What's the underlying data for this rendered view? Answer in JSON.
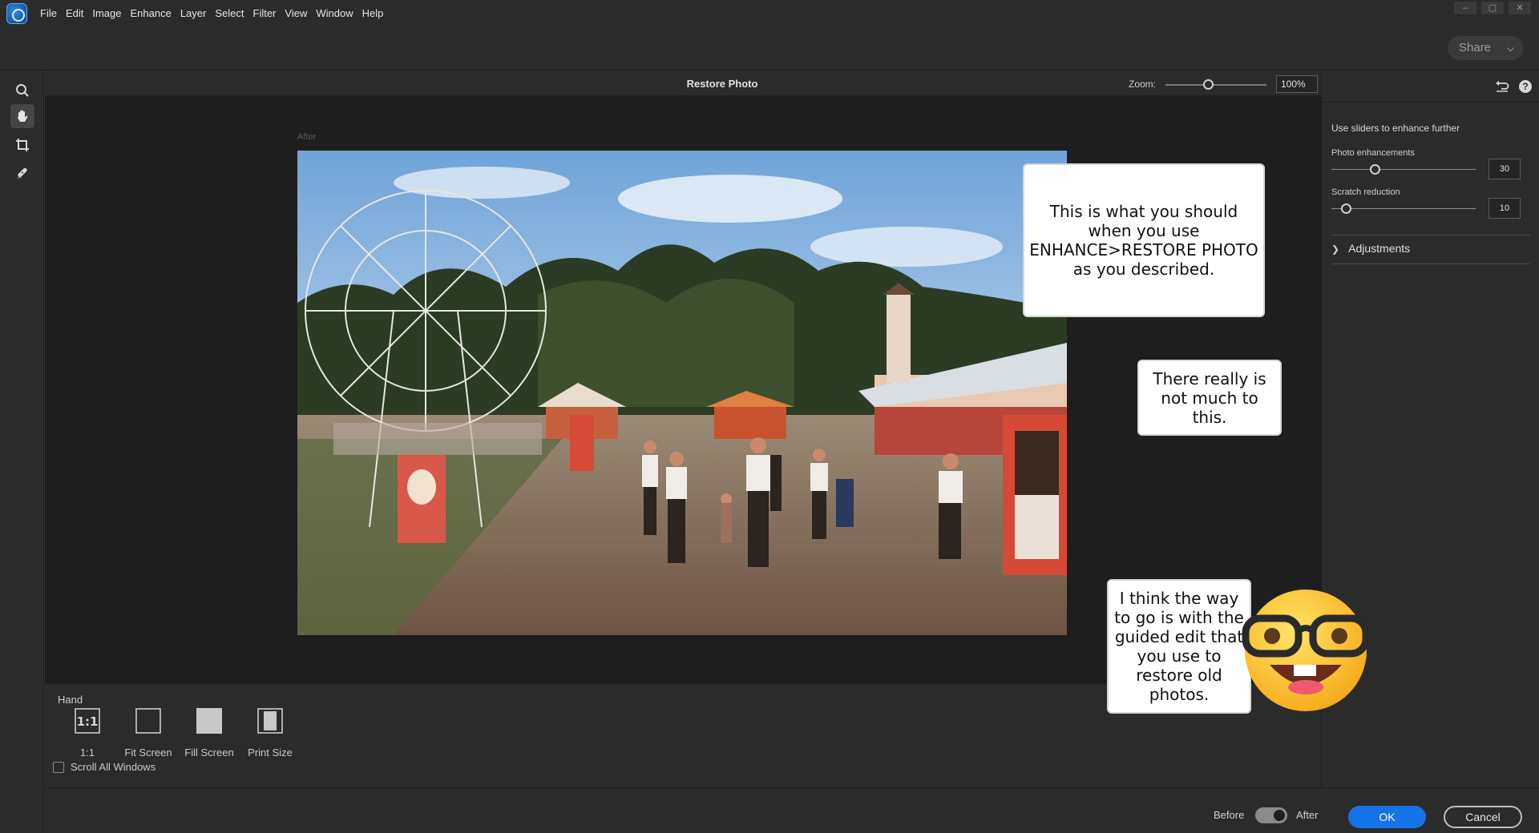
{
  "menu": {
    "items": [
      "File",
      "Edit",
      "Image",
      "Enhance",
      "Layer",
      "Select",
      "Filter",
      "View",
      "Window",
      "Help"
    ]
  },
  "window_controls": [
    "–",
    "▢",
    "✕"
  ],
  "topbar": {
    "share_label": "Share"
  },
  "dialog": {
    "title": "Restore Photo",
    "zoom_label": "Zoom:",
    "zoom_value": "100%",
    "zoom_level_fraction": 0.42,
    "canvas_view_label": "After"
  },
  "tools": [
    "zoom-tool",
    "hand-tool",
    "crop-tool",
    "healing-brush-tool"
  ],
  "tool_options": {
    "title": "Hand",
    "buttons": [
      {
        "label": "1:1",
        "glyph": "1:1"
      },
      {
        "label": "Fit Screen"
      },
      {
        "label": "Fill Screen"
      },
      {
        "label": "Print Size"
      }
    ],
    "scroll_all_label": "Scroll All Windows",
    "scroll_all_checked": false
  },
  "right_panel": {
    "intro": "Use sliders to enhance further",
    "sliders": [
      {
        "label": "Photo enhancements",
        "value": "30",
        "fraction": 0.3
      },
      {
        "label": "Scratch reduction",
        "value": "10",
        "fraction": 0.1
      }
    ],
    "adjustments_label": "Adjustments"
  },
  "footer": {
    "before_label": "Before",
    "after_label": "After",
    "toggle_on": true,
    "ok_label": "OK",
    "cancel_label": "Cancel"
  },
  "annotations": {
    "bubble1": "This is what you should when you use ENHANCE>RESTORE PHOTO as you described.",
    "bubble2": "There really is not much to this.",
    "bubble3": "I think the way to go is with the guided edit that you use to restore old photos."
  },
  "colors": {
    "accent": "#1473e6",
    "panel_bg": "#2b2b2b",
    "canvas_bg": "#1e1e1e"
  }
}
